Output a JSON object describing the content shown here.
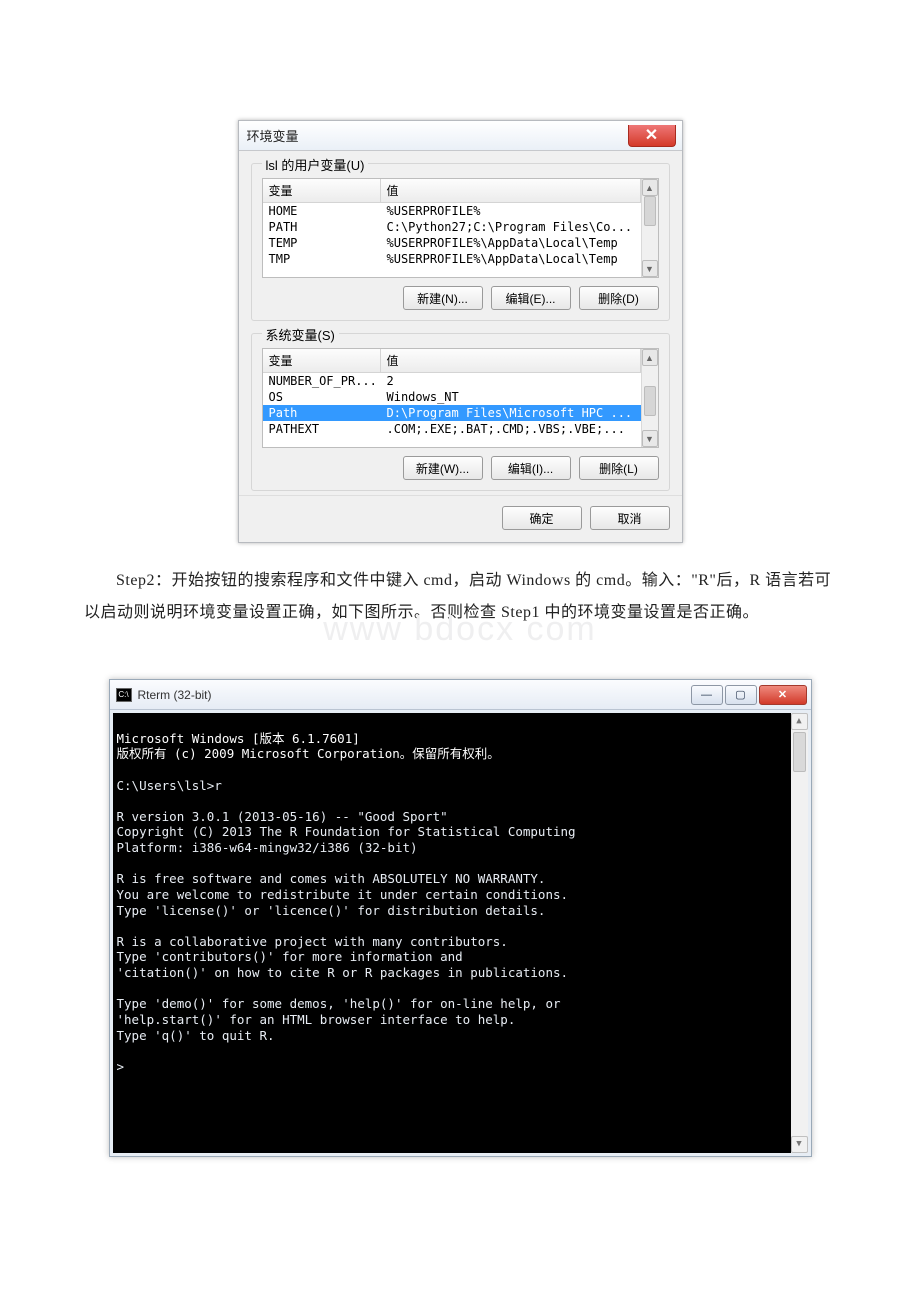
{
  "envdlg": {
    "title": "环境变量",
    "close_x": "✕",
    "user_group_label": "lsl 的用户变量(U)",
    "col_variable": "变量",
    "col_value": "值",
    "user_rows": [
      {
        "var": "HOME",
        "val": "%USERPROFILE%"
      },
      {
        "var": "PATH",
        "val": "C:\\Python27;C:\\Program Files\\Co..."
      },
      {
        "var": "TEMP",
        "val": "%USERPROFILE%\\AppData\\Local\\Temp"
      },
      {
        "var": "TMP",
        "val": "%USERPROFILE%\\AppData\\Local\\Temp"
      }
    ],
    "sys_group_label": "系统变量(S)",
    "sys_rows": [
      {
        "var": "NUMBER_OF_PR...",
        "val": "2",
        "sel": false
      },
      {
        "var": "OS",
        "val": "Windows_NT",
        "sel": false
      },
      {
        "var": "Path",
        "val": "D:\\Program Files\\Microsoft HPC ...",
        "sel": true
      },
      {
        "var": "PATHEXT",
        "val": ".COM;.EXE;.BAT;.CMD;.VBS;.VBE;...",
        "sel": false
      }
    ],
    "btn_new_user": "新建(N)...",
    "btn_edit_user": "编辑(E)...",
    "btn_del_user": "删除(D)",
    "btn_new_sys": "新建(W)...",
    "btn_edit_sys": "编辑(I)...",
    "btn_del_sys": "删除(L)",
    "btn_ok": "确定",
    "btn_cancel": "取消"
  },
  "paragraph": "Step2：开始按钮的搜索程序和文件中键入 cmd，启动 Windows 的 cmd。输入：\"R\"后，R 语言若可以启动则说明环境变量设置正确，如下图所示。否则检查 Step1 中的环境变量设置是否正确。",
  "watermark": "www bdocx com",
  "cmd": {
    "title": "Rterm (32-bit)",
    "icon_text": "C:\\",
    "min_glyph": "—",
    "max_glyph": "▢",
    "close_glyph": "✕",
    "lines": [
      "Microsoft Windows [版本 6.1.7601]",
      "版权所有 (c) 2009 Microsoft Corporation。保留所有权利。",
      "",
      "C:\\Users\\lsl>r",
      "",
      "R version 3.0.1 (2013-05-16) -- \"Good Sport\"",
      "Copyright (C) 2013 The R Foundation for Statistical Computing",
      "Platform: i386-w64-mingw32/i386 (32-bit)",
      "",
      "R is free software and comes with ABSOLUTELY NO WARRANTY.",
      "You are welcome to redistribute it under certain conditions.",
      "Type 'license()' or 'licence()' for distribution details.",
      "",
      "R is a collaborative project with many contributors.",
      "Type 'contributors()' for more information and",
      "'citation()' on how to cite R or R packages in publications.",
      "",
      "Type 'demo()' for some demos, 'help()' for on-line help, or",
      "'help.start()' for an HTML browser interface to help.",
      "Type 'q()' to quit R.",
      "",
      ">"
    ]
  }
}
